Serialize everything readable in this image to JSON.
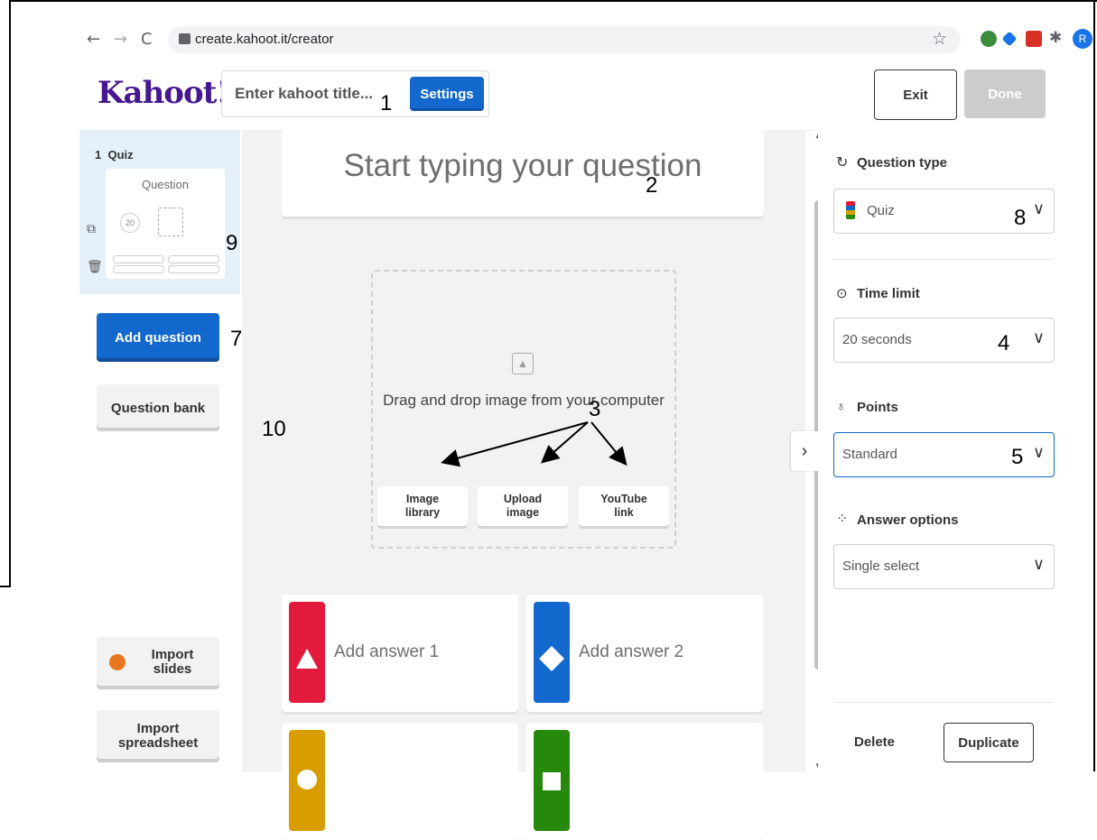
{
  "browser": {
    "back_icon": "←",
    "forward_icon": "→",
    "reload_icon": "C",
    "url": "create.kahoot.it/creator",
    "profile_initial": "R"
  },
  "header": {
    "logo": "Kahoot!",
    "title_placeholder": "Enter kahoot title...",
    "settings_label": "Settings",
    "exit_label": "Exit",
    "done_label": "Done"
  },
  "sidebar": {
    "slide_label": "1  Quiz",
    "thumb_question": "Question",
    "thumb_timer": "20",
    "add_question_label": "Add question",
    "question_bank_label": "Question bank",
    "import_slides_label": "Import\nslides",
    "import_spreadsheet_label": "Import\nspreadsheet"
  },
  "editor": {
    "question_placeholder": "Start typing your question",
    "media_text": "Drag and drop image from your computer",
    "media_buttons": [
      "Image\nlibrary",
      "Upload\nimage",
      "YouTube\nlink"
    ],
    "answers": [
      {
        "label": "Add answer 1",
        "color": "#e21b3c"
      },
      {
        "label": "Add answer 2",
        "color": "#1368ce"
      },
      {
        "label": "",
        "color": "#d89e00"
      },
      {
        "label": "",
        "color": "#26890c"
      }
    ]
  },
  "panel": {
    "question_type_label": "Question type",
    "question_type_value": "Quiz",
    "time_limit_label": "Time limit",
    "time_limit_value": "20 seconds",
    "points_label": "Points",
    "points_value": "Standard",
    "answer_options_label": "Answer options",
    "answer_options_value": "Single select",
    "delete_label": "Delete",
    "duplicate_label": "Duplicate"
  },
  "annotations": [
    "1",
    "2",
    "3",
    "4",
    "5",
    "7",
    "8",
    "9",
    "10"
  ],
  "colors": {
    "brand": "#46178f",
    "primary_blue": "#1368ce",
    "done_disabled": "#cccccc"
  }
}
